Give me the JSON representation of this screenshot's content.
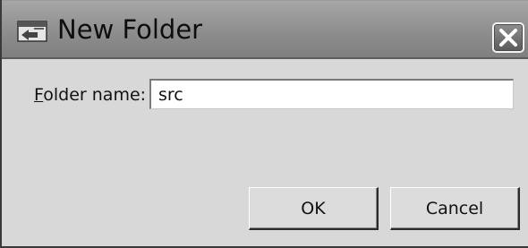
{
  "window": {
    "title": "New Folder",
    "icon": "eclipse-new-folder-icon",
    "close_icon": "close-x-icon"
  },
  "form": {
    "folder_name_label": "Folder name:",
    "folder_name_mnemonic": "F",
    "folder_name_label_rest": "older name:",
    "folder_name_value": "src"
  },
  "buttons": {
    "ok_label": "OK",
    "cancel_label": "Cancel"
  },
  "colors": {
    "dialog_background": "#d8d8d8",
    "titlebar": "#8e8e8e"
  }
}
